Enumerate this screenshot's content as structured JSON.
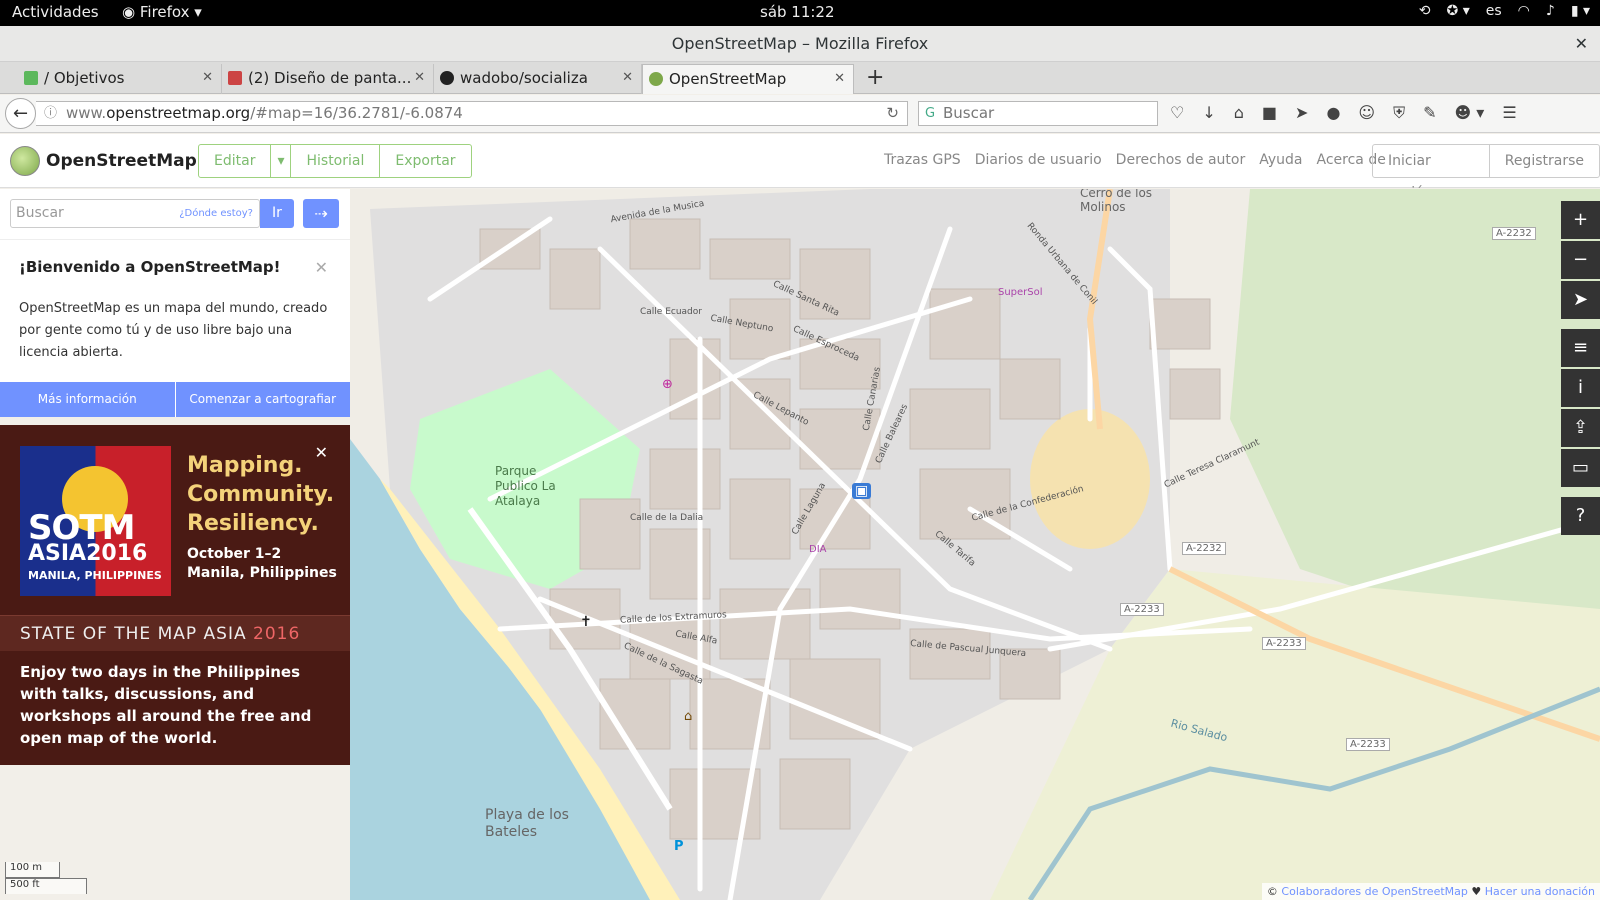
{
  "system": {
    "activities": "Actividades",
    "app": "Firefox",
    "clock": "sáb 11:22",
    "lang": "es"
  },
  "window": {
    "title": "OpenStreetMap – Mozilla Firefox"
  },
  "tabs": [
    {
      "label": "/ Objetivos",
      "icon_color": "#5cb85c"
    },
    {
      "label": "(2) Diseño de panta...",
      "icon_color": "#c44"
    },
    {
      "label": "wadobo/socializa",
      "icon_color": "#222"
    },
    {
      "label": "OpenStreetMap",
      "icon_color": "#7ea84a"
    }
  ],
  "navbar": {
    "url_prefix": "www.",
    "url_host": "openstreetmap.org",
    "url_rest": "/#map=16/36.2781/-6.0874",
    "search_placeholder": "Buscar"
  },
  "osm": {
    "brand": "OpenStreetMap",
    "edit": "Editar",
    "history": "Historial",
    "export": "Exportar",
    "links": [
      "Trazas GPS",
      "Diarios de usuario",
      "Derechos de autor",
      "Ayuda",
      "Acerca de"
    ],
    "login": "Iniciar sesión",
    "signup": "Registrarse"
  },
  "sidebar": {
    "search_placeholder": "Buscar",
    "where_am_i": "¿Dónde estoy?",
    "go": "Ir",
    "welcome_title": "¡Bienvenido a OpenStreetMap!",
    "welcome_text": "OpenStreetMap es un mapa del mundo, creado por gente como tú y de uso libre bajo una licencia abierta.",
    "more_info": "Más información",
    "start_mapping": "Comenzar a cartografiar"
  },
  "banner": {
    "logo_line1": "SOTM",
    "logo_line2": "ASIA2016",
    "logo_line3": "MANILA, PHILIPPINES",
    "tag1": "Mapping.",
    "tag2": "Community.",
    "tag3": "Resiliency.",
    "dates": "October 1–2",
    "place": "Manila, Philippines",
    "band_text": "STATE OF THE MAP ASIA",
    "band_year": "2016",
    "description": "Enjoy two days in the Philippines with talks, discussions, and workshops all around the free and open map of the world."
  },
  "map": {
    "labels": {
      "park": "Parque Publico La Atalaya",
      "beach": "Playa de los Bateles",
      "hills": "Cerro de los Molinos",
      "river": "Rio Salado",
      "supersol": "SuperSol",
      "dia": "DIA",
      "a2232a": "A-2232",
      "a2232b": "A-2232",
      "a2233a": "A-2233",
      "a2233b": "A-2233",
      "a2233c": "A-2233",
      "streets": [
        "Avenida de la Musica",
        "Calle Ecuador",
        "Calle Neptuno",
        "Calle Santa Rita",
        "Calle Esproceda",
        "Calle Lepanto",
        "Calle de la Dalia",
        "Calle de los Extramuros",
        "Calle Alfa",
        "Calle de la Sagasta",
        "Calle Laguna",
        "Calle de la Confederación",
        "Calle de Pascual Junquera",
        "Calle Teresa Claramunt",
        "Ronda Urbana de Conil",
        "Calle Canarias",
        "Calle Baleares",
        "Calle Tarifa"
      ]
    },
    "scale_metric": "100 m",
    "scale_imperial": "500 ft",
    "attribution_prefix": "©",
    "attribution_link": "Colaboradores de OpenStreetMap",
    "attribution_heart": "♥",
    "donate": "Hacer una donación"
  }
}
